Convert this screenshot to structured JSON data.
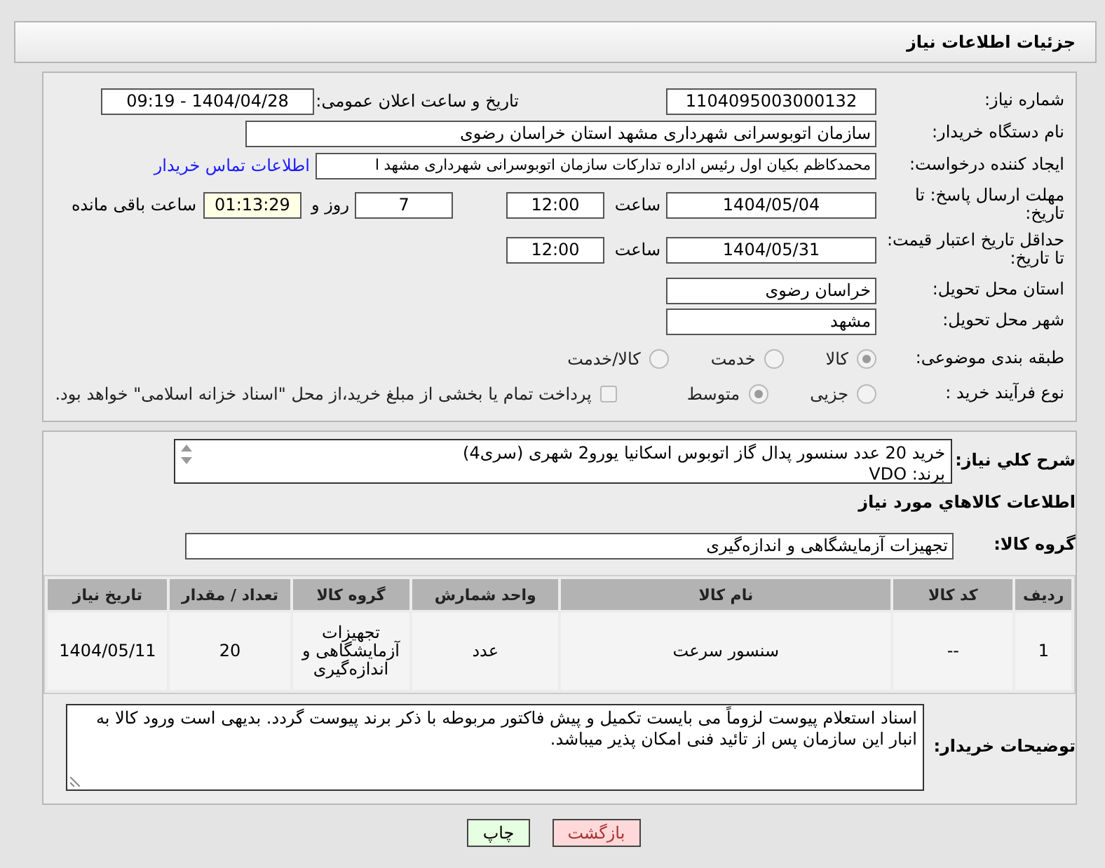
{
  "header": {
    "title": "جزئیات اطلاعات نیاز"
  },
  "need_number": {
    "label": "شماره نیاز:",
    "value": "1104095003000132"
  },
  "announce": {
    "label": "تاریخ و ساعت اعلان عمومی:",
    "value": "1404/04/28 - 09:19"
  },
  "buyer_org": {
    "label": "نام دستگاه خریدار:",
    "value": "سازمان اتوبوسرانی شهرداری مشهد استان خراسان رضوی"
  },
  "requester": {
    "label": "ایجاد کننده درخواست:",
    "value": "محمدکاظم بکیان اول رئیس اداره تدارکات سازمان اتوبوسرانی شهرداری مشهد ا",
    "link": "اطلاعات تماس خریدار"
  },
  "response_deadline": {
    "label": "مهلت ارسال پاسخ: تا تاریخ:",
    "date": "1404/05/04",
    "time_label": "ساعت",
    "time": "12:00",
    "days": "7",
    "days_label": "روز و",
    "remaining": "01:13:29",
    "remaining_label": "ساعت باقی مانده"
  },
  "price_validity": {
    "label": "حداقل تاریخ اعتبار قیمت: تا تاریخ:",
    "date": "1404/05/31",
    "time_label": "ساعت",
    "time": "12:00"
  },
  "delivery_province": {
    "label": "استان محل تحویل:",
    "value": "خراسان رضوی"
  },
  "delivery_city": {
    "label": "شهر محل تحویل:",
    "value": "مشهد"
  },
  "category": {
    "label": "طبقه بندی موضوعی:",
    "options": [
      {
        "label": "کالا",
        "selected": true
      },
      {
        "label": "خدمت",
        "selected": false
      },
      {
        "label": "کالا/خدمت",
        "selected": false
      }
    ]
  },
  "purchase_type": {
    "label": "نوع فرآیند خرید :",
    "options": [
      {
        "label": "جزیی",
        "selected": false
      },
      {
        "label": "متوسط",
        "selected": true
      }
    ],
    "treasury": {
      "label": "پرداخت تمام یا بخشی از مبلغ خرید،از محل \"اسناد خزانه اسلامی\" خواهد بود.",
      "checked": false
    }
  },
  "description": {
    "label": "شرح کلي نياز:",
    "lines": [
      "خرید 20 عدد سنسور پدال گاز اتوبوس اسکانیا یورو2 شهری (سری4)",
      "برند: VDO"
    ]
  },
  "goods_heading": "اطلاعات کالاهاي مورد نياز",
  "goods_group": {
    "label": "گروه کالا:",
    "value": "تجهیزات آزمایشگاهی و اندازه‌گیری"
  },
  "table": {
    "columns": [
      "ردیف",
      "کد کالا",
      "نام کالا",
      "واحد شمارش",
      "گروه کالا",
      "تعداد / مقدار",
      "تاریخ نیاز"
    ],
    "rows": [
      [
        "1",
        "--",
        "سنسور سرعت",
        "عدد",
        "تجهیزات آزمایشگاهی و اندازه‌گیری",
        "20",
        "1404/05/11"
      ]
    ]
  },
  "buyer_notes": {
    "label": "توضیحات خریدار:",
    "value": "اسناد استعلام پیوست لزوماً می بایست تکمیل و پیش فاکتور مربوطه با ذکر برند پیوست گردد. بدیهی است ورود کالا به انبار این سازمان پس از تائید فنی امکان پذیر میباشد."
  },
  "buttons": [
    {
      "label": "بازگشت",
      "kind": "back"
    },
    {
      "label": "چاپ",
      "kind": "print"
    }
  ]
}
